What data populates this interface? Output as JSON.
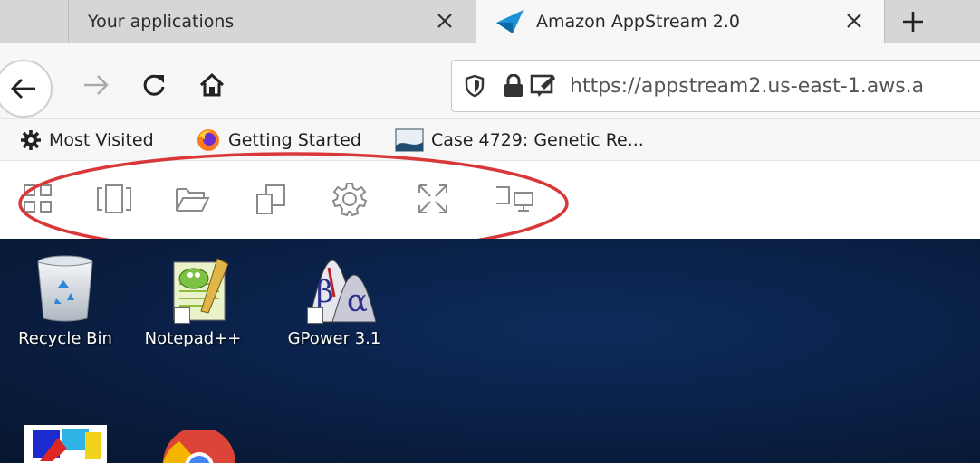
{
  "tabs": [
    {
      "title": "Your applications"
    },
    {
      "title": "Amazon AppStream 2.0"
    }
  ],
  "nav": {
    "url": "https://appstream2.us-east-1.aws.a"
  },
  "bookmarks": [
    {
      "label": "Most Visited",
      "icon": "gear-icon"
    },
    {
      "label": "Getting Started",
      "icon": "firefox-icon"
    },
    {
      "label": "Case 4729: Genetic Re...",
      "icon": "document-icon"
    }
  ],
  "appstream_toolbar": [
    {
      "icon": "catalog-grid-icon"
    },
    {
      "icon": "windows-switcher-icon"
    },
    {
      "icon": "folder-icon"
    },
    {
      "icon": "clipboard-copy-icon"
    },
    {
      "icon": "settings-gear-icon"
    },
    {
      "icon": "fullscreen-icon"
    },
    {
      "icon": "dual-monitor-icon"
    }
  ],
  "desktop_icons": [
    {
      "label": "Recycle Bin"
    },
    {
      "label": "Notepad++"
    },
    {
      "label": "GPower 3.1"
    }
  ],
  "colors": {
    "highlight_ring": "#d9383a",
    "desktop_bg": "#0a1f44",
    "appstream_blue": "#1e90d6"
  }
}
